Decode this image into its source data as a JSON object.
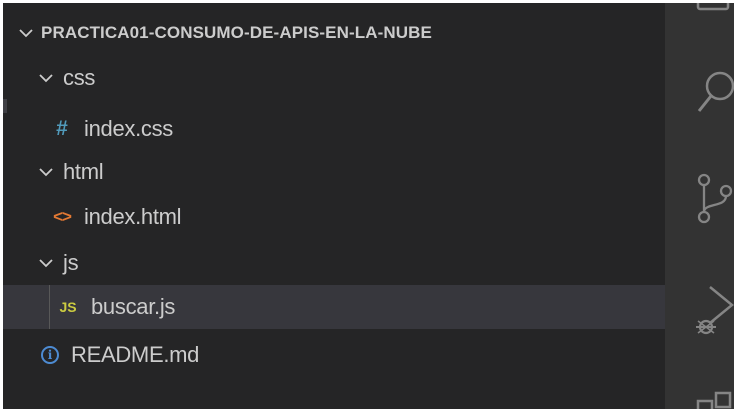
{
  "explorer": {
    "root_folder": "PRACTICA01-CONSUMO-DE-APIS-EN-LA-NUBE",
    "items": [
      {
        "type": "folder",
        "label": "css",
        "expanded": true
      },
      {
        "type": "file",
        "label": "index.css",
        "icon": "hash-icon",
        "icon_glyph": "#",
        "icon_color": "#519aba"
      },
      {
        "type": "folder",
        "label": "html",
        "expanded": true
      },
      {
        "type": "file",
        "label": "index.html",
        "icon": "html-file-icon",
        "icon_glyph": "<>",
        "icon_color": "#e37933"
      },
      {
        "type": "folder",
        "label": "js",
        "expanded": true
      },
      {
        "type": "file",
        "label": "buscar.js",
        "icon": "js-file-icon",
        "icon_glyph": "JS",
        "icon_color": "#cbcb41",
        "selected": true
      },
      {
        "type": "file",
        "label": "README.md",
        "icon": "info-icon",
        "icon_glyph": "i",
        "icon_color": "#4d8bd2"
      }
    ]
  },
  "activity_bar": {
    "icons": [
      "explorer-icon",
      "search-icon",
      "source-control-icon",
      "run-debug-icon",
      "extensions-icon"
    ]
  },
  "colors": {
    "background": "#252526",
    "selection": "#37373d",
    "text": "#cccccc",
    "activity_bar": "#333333"
  }
}
